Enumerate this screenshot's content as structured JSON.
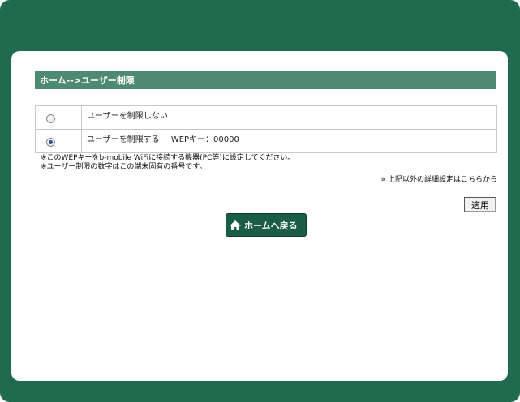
{
  "header": {
    "title": "ホーム-->ユーザー制限"
  },
  "options": [
    {
      "label": "ユーザーを制限しない",
      "selected": false
    },
    {
      "label": "ユーザーを制限する",
      "selected": true,
      "wep_label": "WEPキー：00000"
    }
  ],
  "notes": [
    "※このWEPキーをb-mobile WiFiに接続する機器(PC等)に設定してください。",
    "※ユーザー制限の数字はこの端末固有の番号です。"
  ],
  "detail_link": "» 上記以外の詳細設定はこちらから",
  "apply_label": "適用",
  "home_button": "ホームへ戻る",
  "colors": {
    "frame": "#206b4f",
    "title_bar": "#4e8a72",
    "home_button": "#1a5c45"
  }
}
